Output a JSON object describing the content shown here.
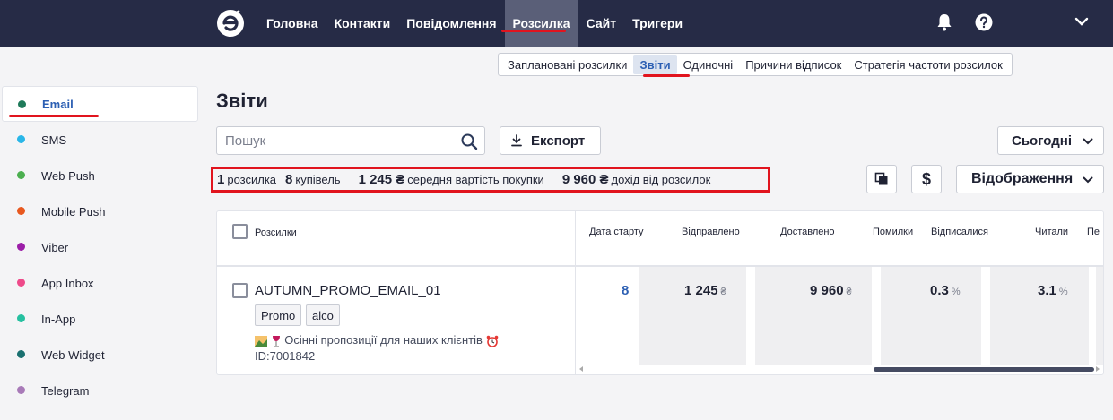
{
  "topnav": {
    "items": [
      {
        "label": "Головна"
      },
      {
        "label": "Контакти"
      },
      {
        "label": "Повідомлення"
      },
      {
        "label": "Розсилка",
        "active": true
      },
      {
        "label": "Сайт"
      },
      {
        "label": "Тригери"
      }
    ]
  },
  "subtabs": [
    {
      "label": "Заплановані розсилки"
    },
    {
      "label": "Звіти",
      "active": true
    },
    {
      "label": "Одиночні"
    },
    {
      "label": "Причини відписок"
    },
    {
      "label": "Стратегія частоти розсилок"
    }
  ],
  "sidebar": {
    "items": [
      {
        "label": "Email",
        "color": "#1f7a5a",
        "active": true
      },
      {
        "label": "SMS",
        "color": "#29b6e8"
      },
      {
        "label": "Web Push",
        "color": "#4caf50"
      },
      {
        "label": "Mobile Push",
        "color": "#e8581f"
      },
      {
        "label": "Viber",
        "color": "#9c1ea8"
      },
      {
        "label": "App Inbox",
        "color": "#ee4a8a"
      },
      {
        "label": "In-App",
        "color": "#26c0a0"
      },
      {
        "label": "Web Widget",
        "color": "#1a7070"
      },
      {
        "label": "Telegram",
        "color": "#a87ab8"
      }
    ]
  },
  "page": {
    "title": "Звіти",
    "search_placeholder": "Пошук",
    "export_label": "Експорт",
    "period_label": "Сьогодні",
    "views_label": "Відображення"
  },
  "stats": [
    {
      "value": "1",
      "label": "розсилка"
    },
    {
      "value": "8",
      "label": "купівель"
    },
    {
      "value": "1 245 ₴",
      "label": "середня вартість покупки"
    },
    {
      "value": "9 960 ₴",
      "label": "дохід від розсилок"
    }
  ],
  "table": {
    "header_left": "Розсилки",
    "columns": [
      "Дата старту",
      "Відправлено",
      "Доставлено",
      "Помилки",
      "Відписалися",
      "Читали",
      "Пе"
    ],
    "rows": [
      {
        "name": "AUTUMN_PROMO_EMAIL_01",
        "tags": [
          "Promo",
          "alco"
        ],
        "subject": "Осінні пропозиції для наших клієнтів",
        "id": "ID:7001842",
        "values": {
          "sent": "8",
          "delivered_value": "1 245",
          "delivered_unit": "₴",
          "errors_value": "9 960",
          "errors_unit": "₴",
          "unsub_value": "0.3",
          "unsub_unit": "%",
          "read_value": "3.1",
          "read_unit": "%"
        }
      }
    ]
  },
  "colors": {
    "navbar": "#262b46",
    "accent_red": "#e1141e",
    "link_blue": "#2c5fb3"
  }
}
